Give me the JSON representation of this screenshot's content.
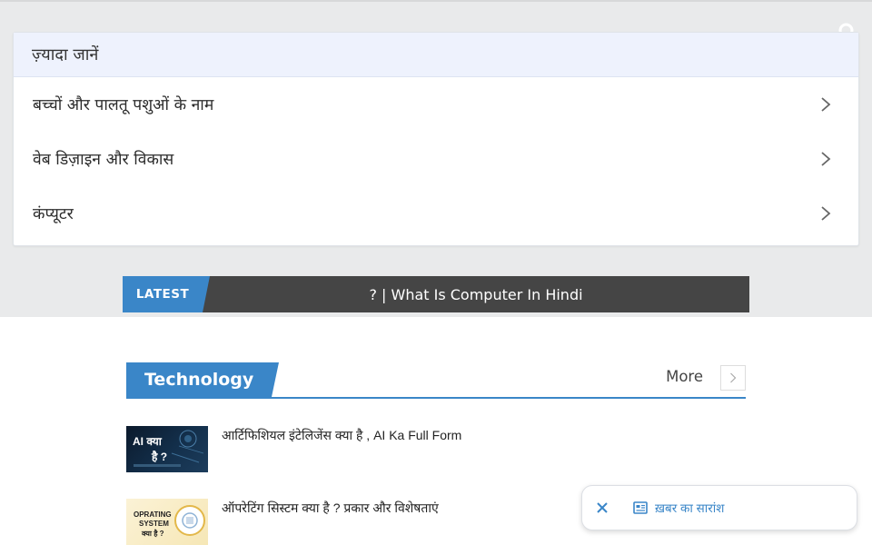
{
  "header": {
    "search_icon": "search-icon"
  },
  "more_card": {
    "title": "ज़्यादा जानें",
    "items": [
      {
        "label": "बच्चों और पालतू पशुओं के नाम"
      },
      {
        "label": "वेब डिज़ाइन और विकास"
      },
      {
        "label": "कंप्यूटर"
      }
    ]
  },
  "ticker": {
    "label": "LATEST",
    "text": "? | What Is Computer In Hindi"
  },
  "section": {
    "title": "Technology",
    "more_label": "More"
  },
  "posts": [
    {
      "title": "आर्टिफिशियल इंटेलिजेंस क्या है , AI Ka Full Form",
      "thumb_line1": "AI क्या",
      "thumb_line2": "है ?"
    },
    {
      "title": "ऑपरेटिंग सिस्टम क्या है ? प्रकार और विशेषताएं",
      "thumb_line1": "OPRATING",
      "thumb_line2": "SYSTEM",
      "thumb_line3": "क्या है ?"
    }
  ],
  "toast": {
    "text": "ख़बर का सारांश"
  },
  "colors": {
    "accent": "#3a86c8",
    "ticker_bg": "#454545",
    "card_head_bg": "#eef2fd",
    "page_bg": "#e9eaeb"
  }
}
